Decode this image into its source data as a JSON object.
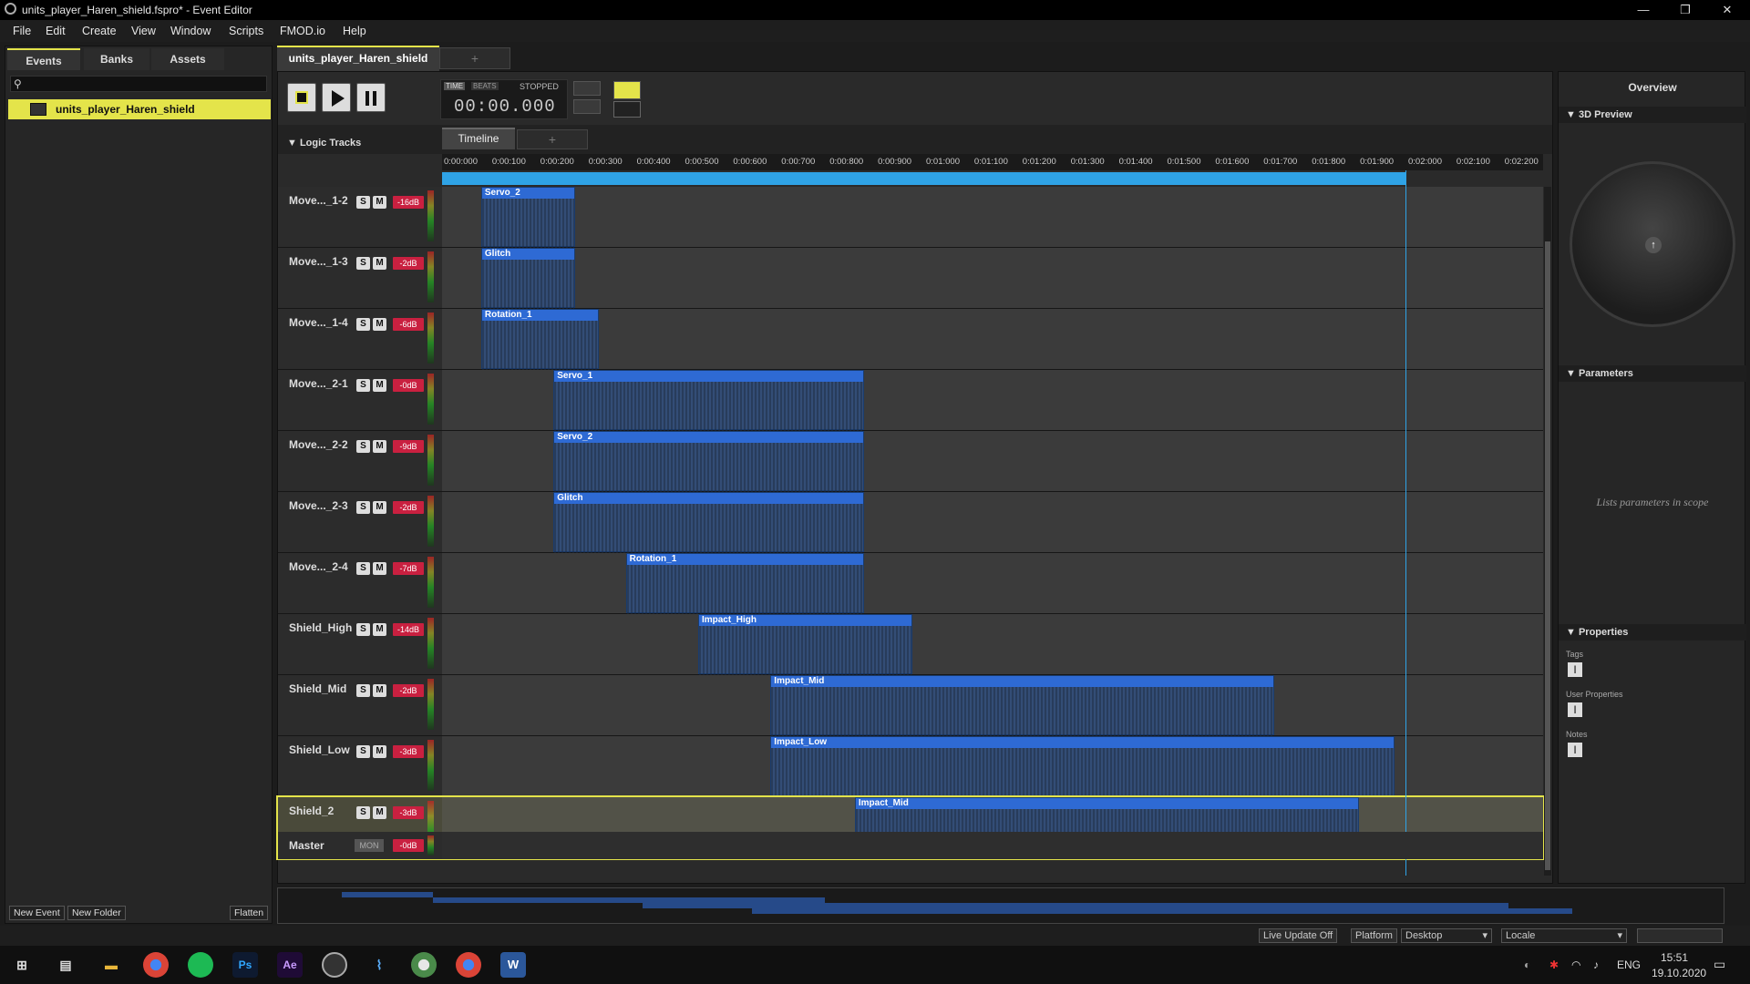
{
  "window": {
    "title": "units_player_Haren_shield.fspro* - Event Editor"
  },
  "menu": [
    "File",
    "Edit",
    "Create",
    "View",
    "Window",
    "Scripts",
    "FMOD.io",
    "Help"
  ],
  "left": {
    "tabs": [
      "Events",
      "Banks",
      "Assets"
    ],
    "event_name": "units_player_Haren_shield",
    "buttons": {
      "new_event": "New Event",
      "new_folder": "New Folder",
      "flatten": "Flatten"
    }
  },
  "editor": {
    "tab_title": "units_player_Haren_shield",
    "add_tab": "+",
    "time_label": "TIME",
    "beats_label": "BEATS",
    "state": "STOPPED",
    "time_value": "00:00.000",
    "timeline_tab": "Timeline",
    "logic_tracks": "Logic Tracks",
    "ruler": [
      "0:00:000",
      "0:00:100",
      "0:00:200",
      "0:00:300",
      "0:00:400",
      "0:00:500",
      "0:00:600",
      "0:00:700",
      "0:00:800",
      "0:00:900",
      "0:01:000",
      "0:01:100",
      "0:01:200",
      "0:01:300",
      "0:01:400",
      "0:01:500",
      "0:01:600",
      "0:01:700",
      "0:01:800",
      "0:01:900",
      "0:02:000",
      "0:02:100",
      "0:02:200"
    ]
  },
  "tracks": [
    {
      "name": "Move..._1-2",
      "vol": "-16dB",
      "clips": [
        {
          "label": "Servo_2",
          "start": 100,
          "end": 295
        }
      ]
    },
    {
      "name": "Move..._1-3",
      "vol": "-2dB",
      "clips": [
        {
          "label": "Glitch",
          "start": 100,
          "end": 295
        }
      ]
    },
    {
      "name": "Move..._1-4",
      "vol": "-6dB",
      "clips": [
        {
          "label": "Rotation_1",
          "start": 100,
          "end": 345
        }
      ]
    },
    {
      "name": "Move..._2-1",
      "vol": "-0dB",
      "clips": [
        {
          "label": "Servo_1",
          "start": 250,
          "end": 895
        }
      ]
    },
    {
      "name": "Move..._2-2",
      "vol": "-9dB",
      "clips": [
        {
          "label": "Servo_2",
          "start": 250,
          "end": 895
        }
      ]
    },
    {
      "name": "Move..._2-3",
      "vol": "-2dB",
      "clips": [
        {
          "label": "Glitch",
          "start": 250,
          "end": 895
        }
      ]
    },
    {
      "name": "Move..._2-4",
      "vol": "-7dB",
      "clips": [
        {
          "label": "Rotation_1",
          "start": 400,
          "end": 895
        }
      ]
    },
    {
      "name": "Shield_High",
      "vol": "-14dB",
      "clips": [
        {
          "label": "Impact_High",
          "start": 550,
          "end": 995
        }
      ]
    },
    {
      "name": "Shield_Mid",
      "vol": "-2dB",
      "clips": [
        {
          "label": "Impact_Mid",
          "start": 700,
          "end": 1745
        }
      ]
    },
    {
      "name": "Shield_Low",
      "vol": "-3dB",
      "clips": [
        {
          "label": "Impact_Low",
          "start": 700,
          "end": 1995
        }
      ]
    },
    {
      "name": "Shield_2",
      "vol": "-3dB",
      "clips": [
        {
          "label": "Impact_Mid",
          "start": 875,
          "end": 1920
        }
      ],
      "selected": true
    }
  ],
  "master": {
    "name": "Master",
    "mon": "MON",
    "vol": "-0dB"
  },
  "right": {
    "title": "Overview",
    "preview": "3D Preview",
    "parameters": "Parameters",
    "parameters_hint": "Lists parameters in scope",
    "properties": "Properties",
    "tags": "Tags",
    "user_properties": "User Properties",
    "notes": "Notes"
  },
  "status": {
    "live_update": "Live Update Off",
    "platform_label": "Platform",
    "platform_value": "Desktop",
    "locale_label": "Locale"
  },
  "taskbar": {
    "lang": "ENG",
    "time": "15:51",
    "date": "19.10.2020"
  },
  "colors": {
    "accent": "#e4e44a",
    "clip": "#2e6ad4",
    "loop": "#2fa3e6",
    "vol": "#c92040"
  }
}
